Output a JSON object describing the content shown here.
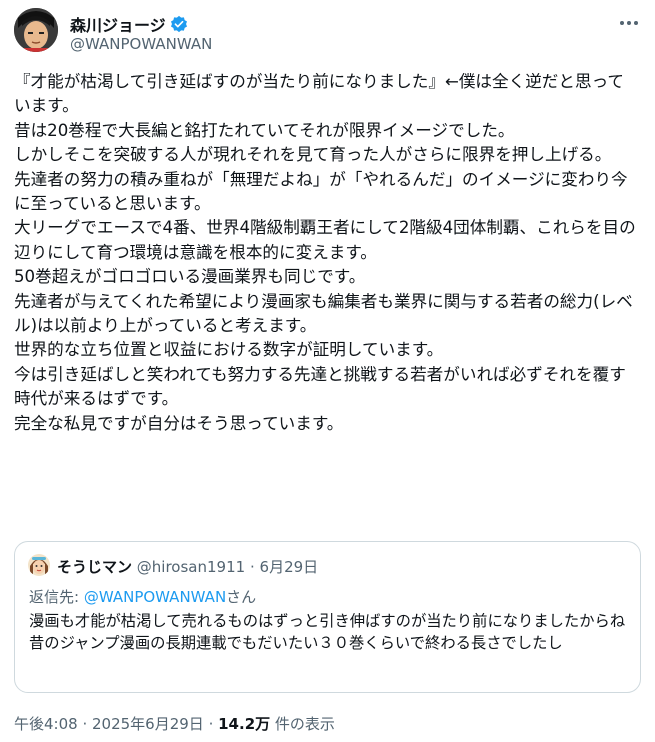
{
  "author": {
    "display_name": "森川ジョージ",
    "handle": "@WANPOWANWAN",
    "verified": true
  },
  "tweet": {
    "text": "『才能が枯渇して引き延ばすのが当たり前になりました』←僕は全く逆だと思っています。\n昔は20巻程で大長編と銘打たれていてそれが限界イメージでした。\nしかしそこを突破する人が現れそれを見て育った人がさらに限界を押し上げる。\n先達者の努力の積み重ねが「無理だよね」が「やれるんだ」のイメージに変わり今に至っていると思います。\n大リーグでエースで4番、世界4階級制覇王者にして2階級4団体制覇、これらを目の辺りにして育つ環境は意識を根本的に変えます。\n50巻超えがゴロゴロいる漫画業界も同じです。\n先達者が与えてくれた希望により漫画家も編集者も業界に関与する若者の総力(レベル)は以前より上がっていると考えます。\n世界的な立ち位置と収益における数字が証明しています。\n今は引き延ばしと笑われても努力する先達と挑戦する若者がいれば必ずそれを覆す時代が来るはずです。\n完全な私見ですが自分はそう思っています。"
  },
  "quote": {
    "display_name": "そうじマン",
    "handle": "@hirosan1911",
    "separator": "·",
    "date": "6月29日",
    "reply_prefix": "返信先: ",
    "reply_to": "@WANPOWANWAN",
    "reply_suffix": "さん",
    "text": "漫画も才能が枯渇して売れるものはずっと引き伸ばすのが当たり前になりましたからね\n昔のジャンプ漫画の長期連載でもだいたい３０巻くらいで終わる長さでしたし"
  },
  "meta": {
    "time": "午後4:08",
    "sep1": " · ",
    "date": "2025年6月29日",
    "sep2": " · ",
    "views": "14.2万",
    "views_label": " 件の表示"
  },
  "colors": {
    "text": "#0f1419",
    "secondary": "#536471",
    "accent": "#1d9bf0",
    "border": "#cfd9de"
  },
  "icons": {
    "verified": "verified-badge-icon",
    "more": "more-options-icon"
  }
}
